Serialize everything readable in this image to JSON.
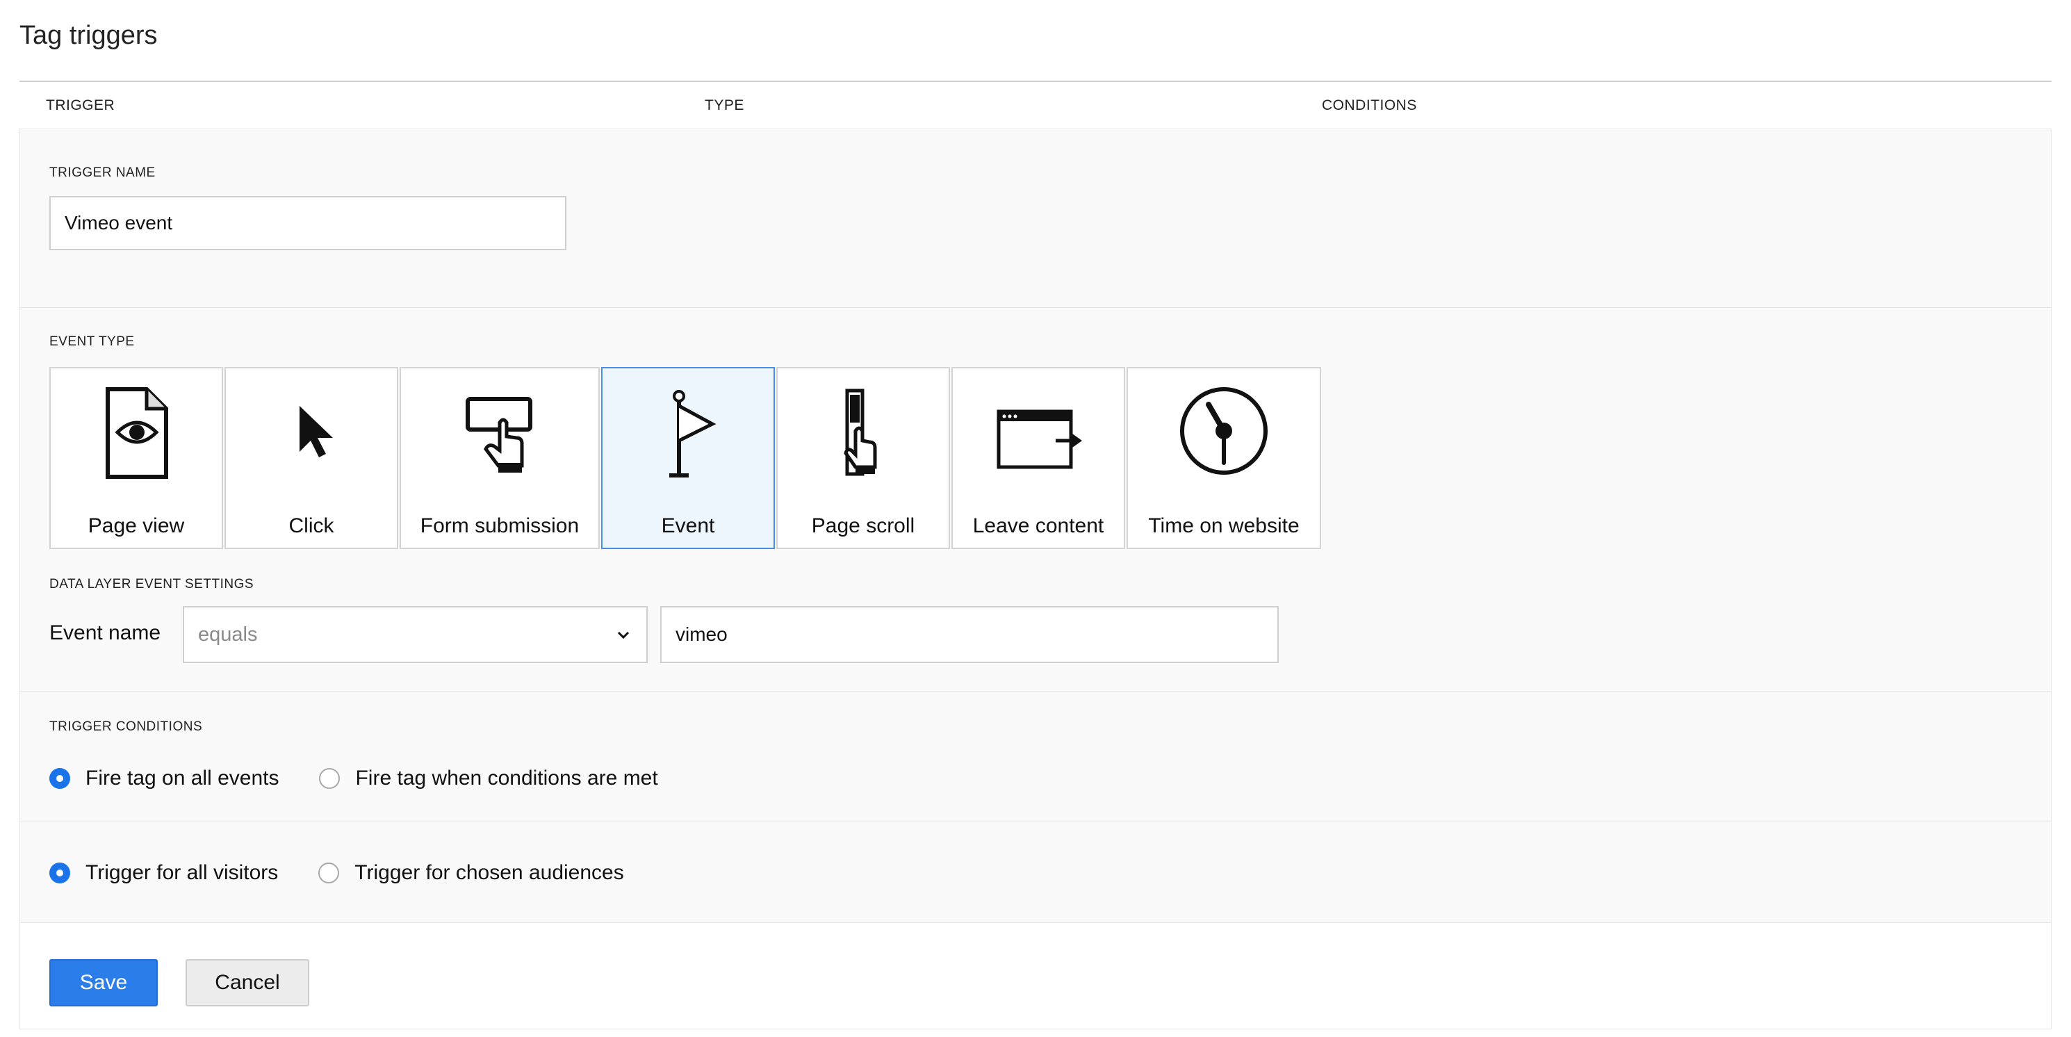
{
  "page": {
    "title": "Tag triggers"
  },
  "table": {
    "columns": [
      "TRIGGER",
      "TYPE",
      "CONDITIONS"
    ]
  },
  "trigger_name": {
    "label": "TRIGGER NAME",
    "value": "Vimeo event"
  },
  "event_type": {
    "label": "EVENT TYPE",
    "selected": "Event",
    "options": [
      {
        "label": "Page view",
        "icon": "page-view-icon"
      },
      {
        "label": "Click",
        "icon": "cursor-icon"
      },
      {
        "label": "Form submission",
        "icon": "form-submission-icon"
      },
      {
        "label": "Event",
        "icon": "flag-icon"
      },
      {
        "label": "Page scroll",
        "icon": "page-scroll-icon"
      },
      {
        "label": "Leave content",
        "icon": "leave-content-icon"
      },
      {
        "label": "Time on website",
        "icon": "clock-icon"
      }
    ]
  },
  "data_layer": {
    "label": "DATA LAYER EVENT SETTINGS",
    "field_label": "Event name",
    "operator": "equals",
    "value": "vimeo"
  },
  "trigger_conditions": {
    "label": "TRIGGER CONDITIONS",
    "options": [
      {
        "label": "Fire tag on all events",
        "selected": true
      },
      {
        "label": "Fire tag when conditions are met",
        "selected": false
      }
    ]
  },
  "audience": {
    "options": [
      {
        "label": "Trigger for all visitors",
        "selected": true
      },
      {
        "label": "Trigger for chosen audiences",
        "selected": false
      }
    ]
  },
  "actions": {
    "save": "Save",
    "cancel": "Cancel"
  },
  "colors": {
    "accent": "#2b7de9",
    "selected_tile_bg": "#eef6fd",
    "selected_tile_border": "#4a90e2"
  }
}
